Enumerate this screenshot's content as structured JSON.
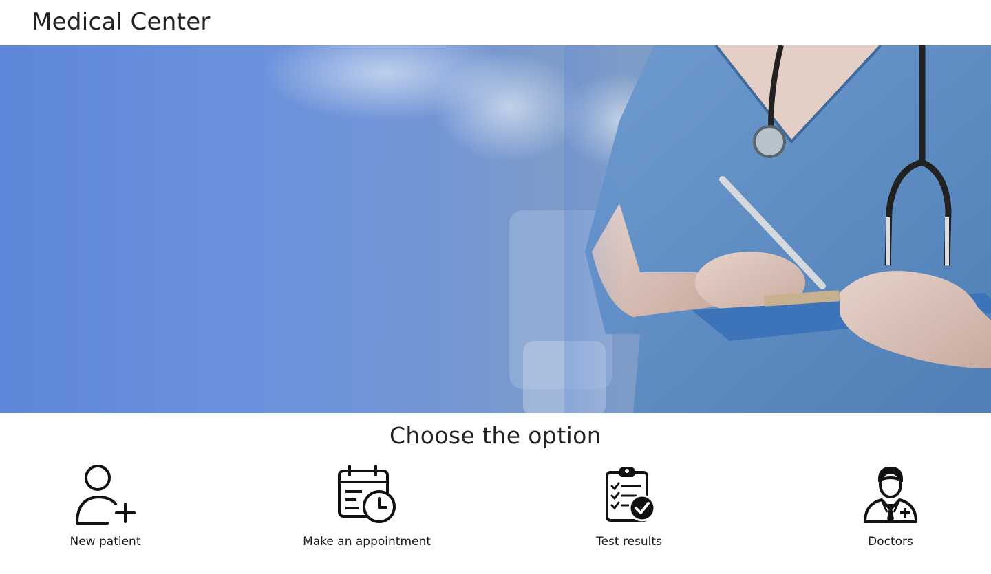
{
  "header": {
    "title": "Medical Center"
  },
  "hero": {
    "image": "doctor-with-stethoscope-and-clipboard",
    "accent_color": "#5e86d8"
  },
  "options_section": {
    "title": "Choose the option",
    "items": [
      {
        "label": "New patient",
        "icon": "user-plus-icon"
      },
      {
        "label": "Make an appointment",
        "icon": "calendar-clock-icon"
      },
      {
        "label": "Test results",
        "icon": "clipboard-check-icon"
      },
      {
        "label": "Doctors",
        "icon": "doctor-icon"
      }
    ]
  }
}
